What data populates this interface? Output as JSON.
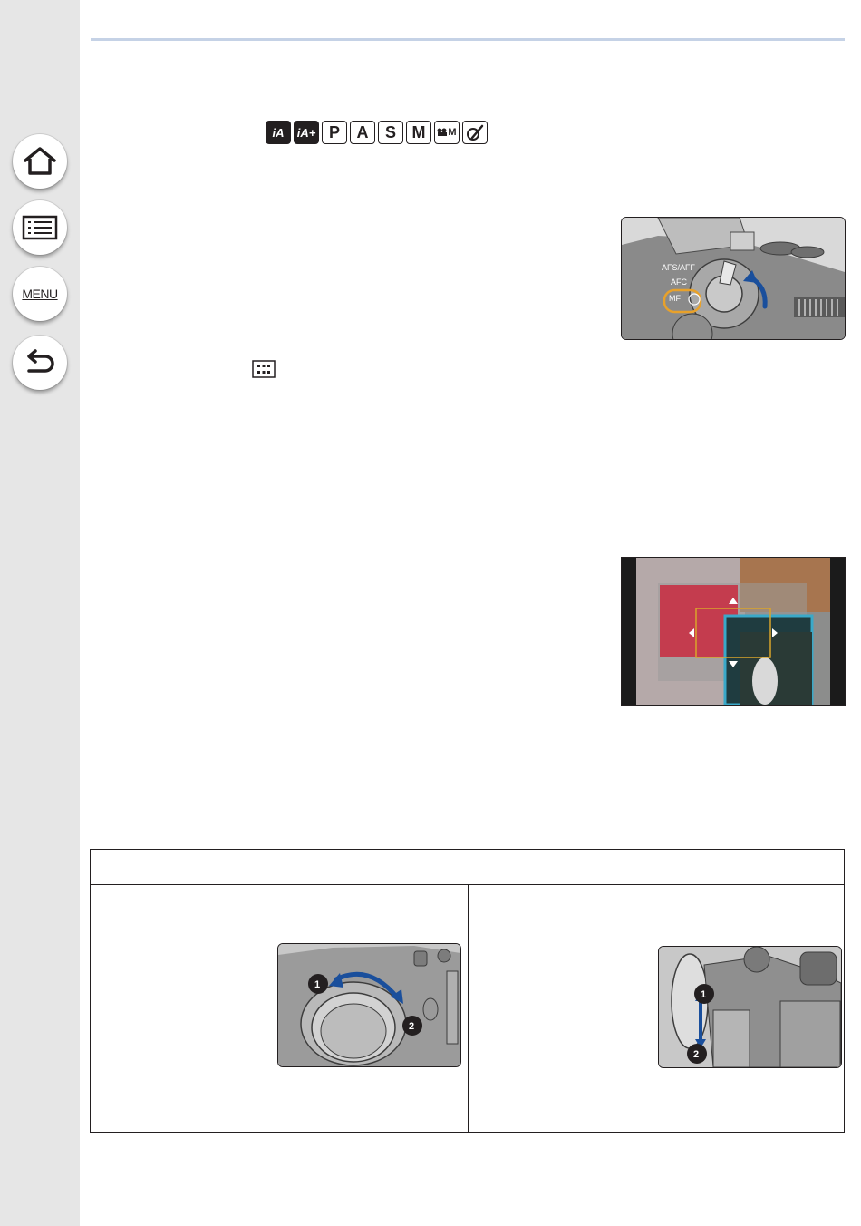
{
  "sidebar": {
    "home_icon": "home-icon",
    "contents_icon": "table-of-contents-icon",
    "menu_label": "MENU",
    "back_icon": "back-arrow-icon"
  },
  "mode_icons": [
    {
      "label": "iA",
      "style": "dark",
      "name": "intelligent-auto"
    },
    {
      "label": "iA+",
      "style": "dark",
      "name": "intelligent-auto-plus"
    },
    {
      "label": "P",
      "style": "plain",
      "name": "program-ae"
    },
    {
      "label": "A",
      "style": "plain",
      "name": "aperture-priority"
    },
    {
      "label": "S",
      "style": "plain",
      "name": "shutter-priority"
    },
    {
      "label": "M",
      "style": "plain",
      "name": "manual-exposure"
    },
    {
      "label": "M",
      "style": "small",
      "name": "creative-video"
    },
    {
      "label": "",
      "style": "plain",
      "name": "creative-control"
    }
  ],
  "focus_lever": {
    "labels": [
      "AFS/AFF",
      "AFC",
      "MF"
    ],
    "highlight_color": "#e8a12a",
    "arrow_color": "#1a4f9c"
  },
  "af_area_icon": "af-area-grid-icon",
  "mf_assist": {
    "frame_color": "#d9a42a"
  },
  "table": {
    "left_markers": [
      "1",
      "2"
    ],
    "right_markers": [
      "1",
      "2"
    ],
    "arrow_color": "#1a4f9c"
  },
  "page_number": ""
}
